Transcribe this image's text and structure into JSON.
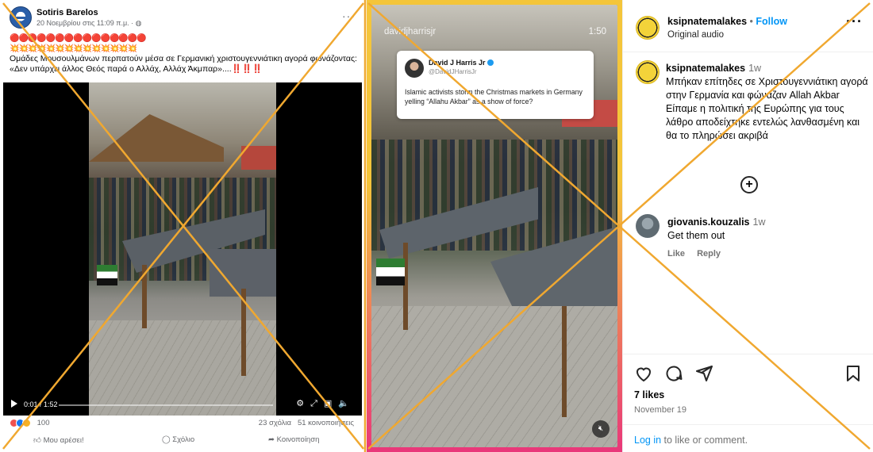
{
  "facebook": {
    "author": "Sotiris Barelos",
    "timestamp": "20 Νοεμβρίου στις 11:09 π.μ. · ",
    "emoji_row_1": "🔴🔴🔴🔴🔴🔴🔴🔴🔴🔴🔴🔴🔴🔴🔴",
    "emoji_row_2": "💥💥💥💥💥💥💥💥💥💥💥💥💥💥",
    "text_line_1": "Ομάδες Μουσουλμάνων περπατούν μέσα σε Γερμανική χριστουγεννιάτικη αγορά φωνάζοντας:",
    "text_line_2": "«Δεν υπάρχει άλλος Θεός παρά ο Αλλάχ, Αλλάχ Άκμπαρ»....",
    "text_marks": "‼️‼️‼️",
    "video_time": "0:01 / 1:52",
    "reactions_count": "100",
    "comments": "23 σχόλια",
    "shares": "51 κοινοποιήσεις",
    "action_like": "Μου αρέσει!",
    "action_comment": "Σχόλιο",
    "action_share": "Κοινοποίηση"
  },
  "reel": {
    "username": "davidjharrisjr",
    "duration": "1:50",
    "tweet": {
      "name": "David J Harris Jr",
      "handle": "@DavidJHarrisJr",
      "text": "Islamic activists storm the Christmas markets in Germany yelling “Allahu Akbar” as a show of force?"
    }
  },
  "instagram": {
    "username": "ksipnatemalakes",
    "follow_label": "Follow",
    "audio": "Original audio",
    "caption_user": "ksipnatemalakes",
    "caption_time": "1w",
    "caption_text": "Μπήκαν επίτηδες σε Χριστουγεννιάτικη αγορά στην Γερμανία και φώναζαν Allah Akbar",
    "caption_text_2": "Είπαμε η πολιτική της Ευρώπης για τους λάθρο αποδείχτηκε εντελώς λανθασμένη και θα το πληρώσει ακριβά",
    "comment_user": "giovanis.kouzalis",
    "comment_time": "1w",
    "comment_text": "Get them out",
    "comment_like": "Like",
    "comment_reply": "Reply",
    "likes": "7 likes",
    "date": "November 19",
    "login_link": "Log in",
    "login_text": " to like or comment."
  },
  "colors": {
    "cross_lines": "#f0a830",
    "ig_blue": "#0095f6",
    "fb_gray": "#65676b"
  }
}
